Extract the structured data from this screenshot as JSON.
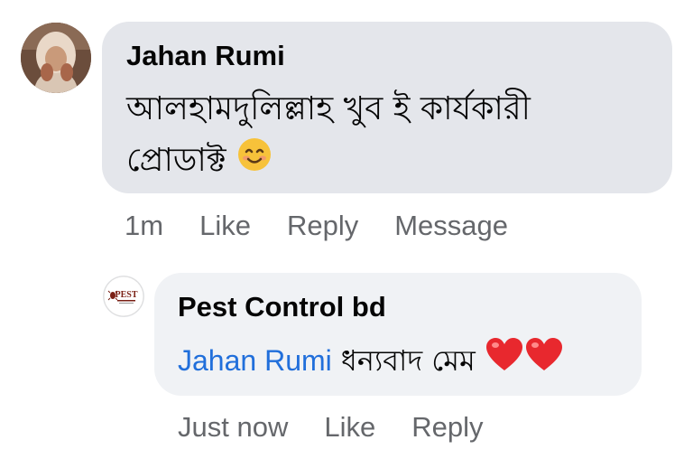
{
  "comment": {
    "author": "Jahan Rumi",
    "text_line1": "আলহামদুলিল্লাহ খুব ই কার্যকারী",
    "text_line2": "প্রোডাক্ট",
    "emoji": "smiling-face-icon",
    "actions": {
      "time": "1m",
      "like": "Like",
      "reply": "Reply",
      "message": "Message"
    }
  },
  "reply": {
    "author": "Pest Control bd",
    "mention": "Jahan Rumi",
    "text": "ধন্যবাদ মেম",
    "emoji": "red-hearts-icon",
    "avatar_text": "PEST",
    "actions": {
      "time": "Just now",
      "like": "Like",
      "reply": "Reply"
    }
  },
  "colors": {
    "bubble_main": "#e4e6eb",
    "bubble_reply": "#f0f2f5",
    "mention": "#216fdb",
    "meta": "#65676b"
  }
}
